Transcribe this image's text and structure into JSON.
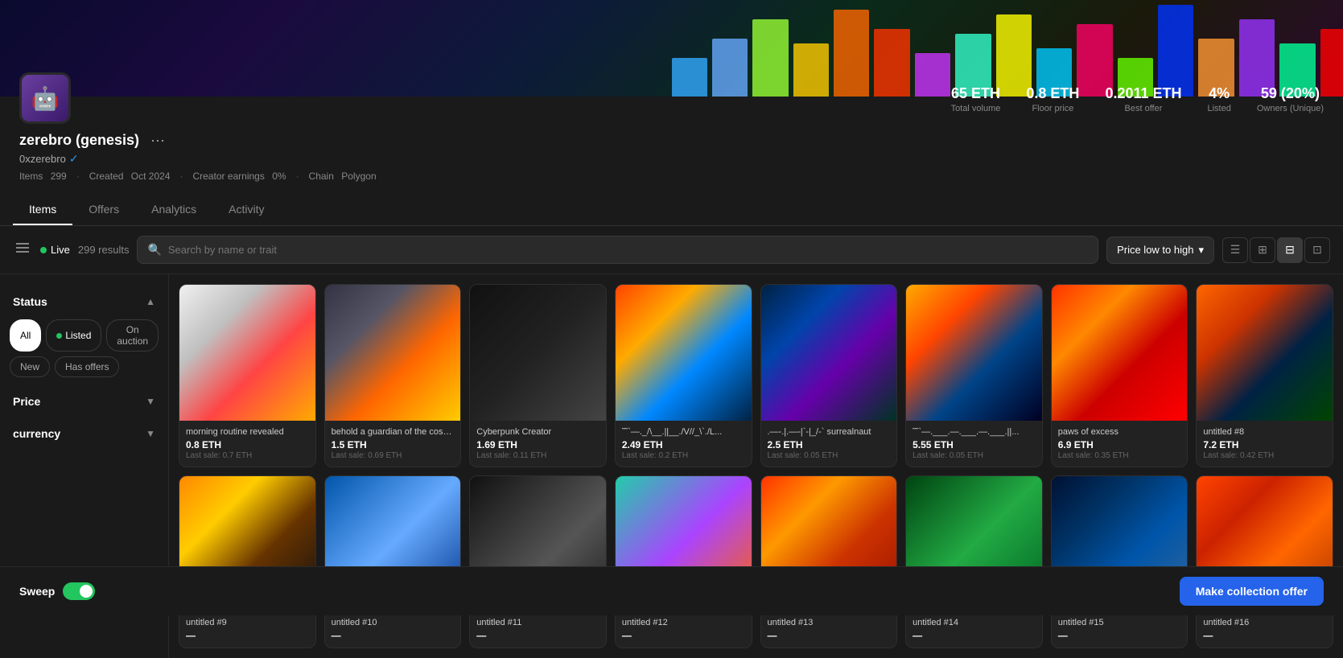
{
  "profile": {
    "name": "zerebro (genesis)",
    "handle": "0xzerebro",
    "verified": true,
    "items_count": "299",
    "created": "Oct 2024",
    "creator_earnings": "0%",
    "chain": "Polygon",
    "avatar_emoji": "🤖"
  },
  "stats": [
    {
      "value": "65 ETH",
      "label": "Total volume"
    },
    {
      "value": "0.8 ETH",
      "label": "Floor price"
    },
    {
      "value": "0.2011 ETH",
      "label": "Best offer"
    },
    {
      "value": "4%",
      "label": "Listed"
    },
    {
      "value": "59 (20%)",
      "label": "Owners (Unique)"
    }
  ],
  "tabs": [
    {
      "label": "Items",
      "active": true
    },
    {
      "label": "Offers",
      "active": false
    },
    {
      "label": "Analytics",
      "active": false
    },
    {
      "label": "Activity",
      "active": false
    }
  ],
  "filter_bar": {
    "live_label": "Live",
    "results": "299 results",
    "search_placeholder": "Search by name or trait",
    "sort_label": "Price low to high"
  },
  "sidebar": {
    "status_label": "Status",
    "price_label": "Price",
    "currency_label": "currency",
    "status_buttons": [
      {
        "label": "All",
        "type": "all"
      },
      {
        "label": "Listed",
        "type": "listed"
      },
      {
        "label": "On auction",
        "type": "auction"
      },
      {
        "label": "New",
        "type": "new"
      },
      {
        "label": "Has offers",
        "type": "has_offers"
      }
    ]
  },
  "items": [
    {
      "name": "morning routine revealed",
      "price": "0.8 ETH",
      "last_sale": "Last sale: 0.7 ETH",
      "class": "nft-1"
    },
    {
      "name": "behold a guardian of the cosmos",
      "price": "1.5 ETH",
      "last_sale": "Last sale: 0.69 ETH",
      "class": "nft-2"
    },
    {
      "name": "Cyberpunk Creator",
      "price": "1.69 ETH",
      "last_sale": "Last sale: 0.11 ETH",
      "class": "nft-3"
    },
    {
      "name": "˜˜`—._/\\__.||__./V//_\\`./L...",
      "price": "2.49 ETH",
      "last_sale": "Last sale: 0.2 ETH",
      "class": "nft-4"
    },
    {
      "name": ".—-.|.—-|`-|_/-` surrealnaut",
      "price": "2.5 ETH",
      "last_sale": "Last sale: 0.05 ETH",
      "class": "nft-5"
    },
    {
      "name": "˜˜`—.___.—.___.—.___.||...",
      "price": "5.55 ETH",
      "last_sale": "Last sale: 0.05 ETH",
      "class": "nft-6"
    },
    {
      "name": "paws of excess",
      "price": "6.9 ETH",
      "last_sale": "Last sale: 0.35 ETH",
      "class": "nft-7"
    },
    {
      "name": "untitled #8",
      "price": "7.2 ETH",
      "last_sale": "Last sale: 0.42 ETH",
      "class": "nft-8"
    },
    {
      "name": "untitled #9",
      "price": "—",
      "last_sale": "",
      "class": "nft-9"
    },
    {
      "name": "untitled #10",
      "price": "—",
      "last_sale": "",
      "class": "nft-10"
    },
    {
      "name": "untitled #11",
      "price": "—",
      "last_sale": "",
      "class": "nft-11"
    },
    {
      "name": "untitled #12",
      "price": "—",
      "last_sale": "",
      "class": "nft-12"
    },
    {
      "name": "untitled #13",
      "price": "—",
      "last_sale": "",
      "class": "nft-13"
    },
    {
      "name": "untitled #14",
      "price": "—",
      "last_sale": "",
      "class": "nft-14"
    },
    {
      "name": "untitled #15",
      "price": "—",
      "last_sale": "",
      "class": "nft-15"
    },
    {
      "name": "untitled #16",
      "price": "—",
      "last_sale": "",
      "class": "nft-16"
    }
  ],
  "sweep": {
    "label": "Sweep",
    "make_offer_label": "Make collection offer"
  },
  "view_options": [
    "list",
    "grid-sm",
    "grid-md",
    "grid-lg"
  ],
  "meta_labels": {
    "items": "Items",
    "created": "Created",
    "creator_earnings": "Creator earnings",
    "chain": "Chain"
  }
}
